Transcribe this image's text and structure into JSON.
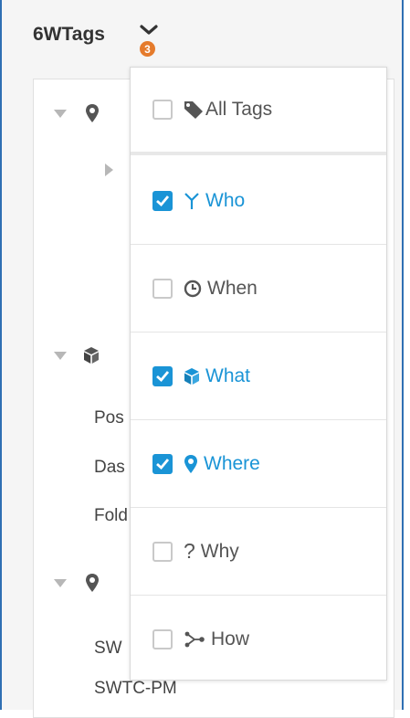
{
  "header": {
    "title": "6WTags",
    "badge_count": "3"
  },
  "tree": {
    "rows": [
      {
        "text": "Pos"
      },
      {
        "text": "Das"
      },
      {
        "text": "Fold"
      },
      {
        "text": "SW"
      },
      {
        "text": "SWTC-PM"
      }
    ]
  },
  "dropdown": {
    "options": [
      {
        "label": "All Tags",
        "checked": false,
        "icon": "tag-icon"
      },
      {
        "label": "Who",
        "checked": true,
        "icon": "who-icon"
      },
      {
        "label": "When",
        "checked": false,
        "icon": "clock-icon"
      },
      {
        "label": "What",
        "checked": true,
        "icon": "cube-icon"
      },
      {
        "label": "Where",
        "checked": true,
        "icon": "map-marker-icon"
      },
      {
        "label": "Why",
        "checked": false,
        "icon": "question-icon"
      },
      {
        "label": "How",
        "checked": false,
        "icon": "share-nodes-icon"
      }
    ]
  },
  "colors": {
    "accent": "#1a94d6",
    "badge": "#e57b2c",
    "frame": "#2f6fb3"
  }
}
